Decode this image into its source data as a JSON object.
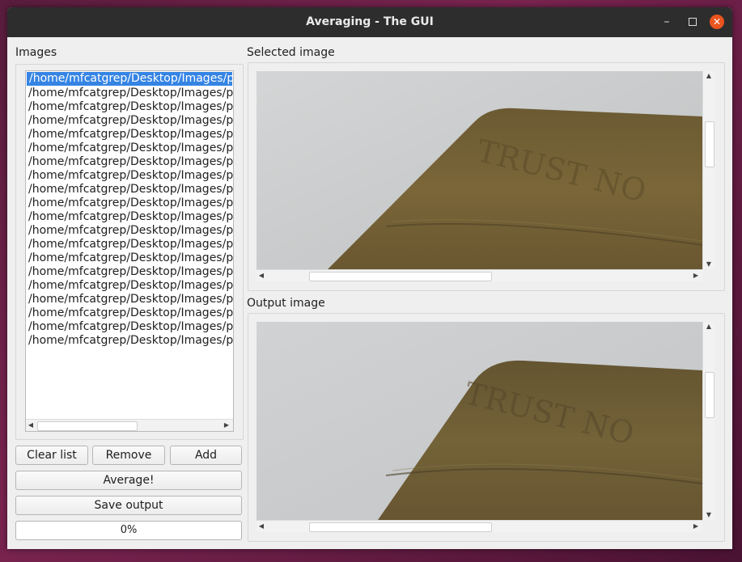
{
  "window": {
    "title": "Averaging - The GUI"
  },
  "images_panel": {
    "label": "Images",
    "items": [
      "/home/mfcatgrep/Desktop/Images/p",
      "/home/mfcatgrep/Desktop/Images/p",
      "/home/mfcatgrep/Desktop/Images/p",
      "/home/mfcatgrep/Desktop/Images/p",
      "/home/mfcatgrep/Desktop/Images/p",
      "/home/mfcatgrep/Desktop/Images/p",
      "/home/mfcatgrep/Desktop/Images/p",
      "/home/mfcatgrep/Desktop/Images/p",
      "/home/mfcatgrep/Desktop/Images/p",
      "/home/mfcatgrep/Desktop/Images/p",
      "/home/mfcatgrep/Desktop/Images/p",
      "/home/mfcatgrep/Desktop/Images/p",
      "/home/mfcatgrep/Desktop/Images/p",
      "/home/mfcatgrep/Desktop/Images/p",
      "/home/mfcatgrep/Desktop/Images/p",
      "/home/mfcatgrep/Desktop/Images/p",
      "/home/mfcatgrep/Desktop/Images/p",
      "/home/mfcatgrep/Desktop/Images/p",
      "/home/mfcatgrep/Desktop/Images/p",
      "/home/mfcatgrep/Desktop/Images/p"
    ],
    "selected_index": 0
  },
  "buttons": {
    "clear_list": "Clear list",
    "remove": "Remove",
    "add": "Add",
    "average": "Average!",
    "save_output": "Save output"
  },
  "progress": {
    "text": "0%",
    "value": 0
  },
  "selected_image": {
    "label": "Selected image"
  },
  "output_image": {
    "label": "Output image"
  },
  "colors": {
    "selection": "#3584e4",
    "close_button": "#e9541f",
    "titlebar": "#2d2d2d"
  },
  "icons": {
    "minimize": "minimize-icon",
    "maximize": "maximize-icon",
    "close": "close-icon"
  }
}
